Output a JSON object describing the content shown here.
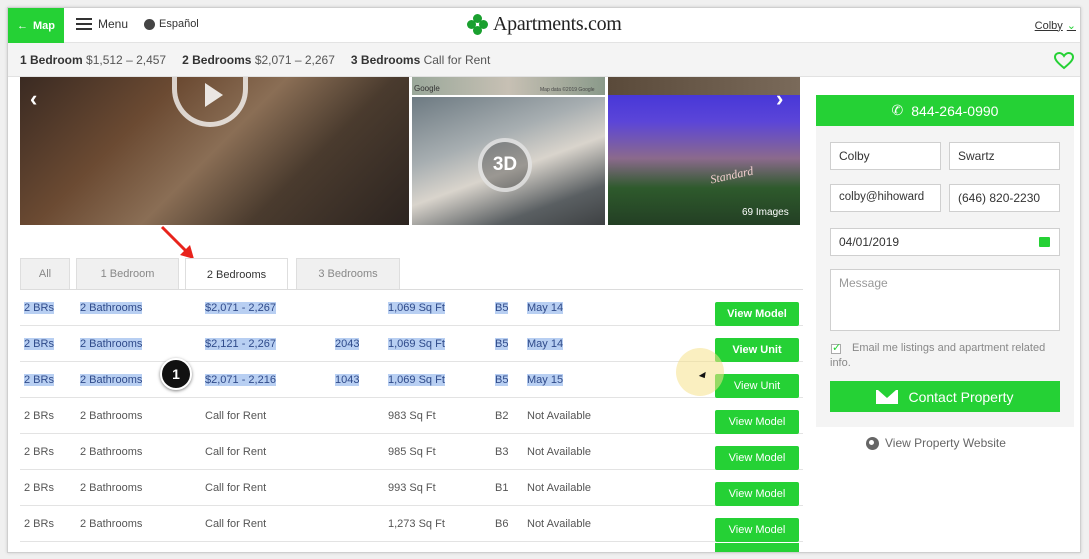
{
  "header": {
    "map_label": "Map",
    "menu_label": "Menu",
    "language_label": "Español",
    "logo_text": "Apartments.com",
    "user_name": "Colby"
  },
  "price_bar": {
    "items": [
      {
        "label": "1 Bedroom",
        "value": "$1,512 – 2,457"
      },
      {
        "label": "2 Bedrooms",
        "value": "$2,071 – 2,267"
      },
      {
        "label": "3 Bedrooms",
        "value": "Call for Rent"
      }
    ]
  },
  "gallery": {
    "image_count": "69 Images",
    "badge_3d": "3D",
    "map_logo": "Google",
    "map_data": "Map data ©2019 Google",
    "storefront_sign": "Standard"
  },
  "tabs": [
    {
      "label": "All",
      "active": false
    },
    {
      "label": "1 Bedroom",
      "active": false
    },
    {
      "label": "2 Bedrooms",
      "active": true
    },
    {
      "label": "3 Bedrooms",
      "active": false
    }
  ],
  "units": [
    {
      "beds": "2 BRs",
      "baths": "2 Bathrooms",
      "price": "$2,071 - 2,267",
      "unit": "",
      "sqft": "1,069 Sq Ft",
      "plan": "B5",
      "avail": "May 14",
      "button": "View Model",
      "selected": true
    },
    {
      "beds": "2 BRs",
      "baths": "2 Bathrooms",
      "price": "$2,121 - 2,267",
      "unit": "2043",
      "sqft": "1,069 Sq Ft",
      "plan": "B5",
      "avail": "May 14",
      "button": "View Unit",
      "selected": true
    },
    {
      "beds": "2 BRs",
      "baths": "2 Bathrooms",
      "price": "$2,071 - 2,216",
      "unit": "1043",
      "sqft": "1,069 Sq Ft",
      "plan": "B5",
      "avail": "May 15",
      "button": "View Unit",
      "selected": true
    },
    {
      "beds": "2 BRs",
      "baths": "2 Bathrooms",
      "price": "Call for Rent",
      "unit": "",
      "sqft": "983 Sq Ft",
      "plan": "B2",
      "avail": "Not Available",
      "button": "View Model",
      "selected": false
    },
    {
      "beds": "2 BRs",
      "baths": "2 Bathrooms",
      "price": "Call for Rent",
      "unit": "",
      "sqft": "985 Sq Ft",
      "plan": "B3",
      "avail": "Not Available",
      "button": "View Model",
      "selected": false
    },
    {
      "beds": "2 BRs",
      "baths": "2 Bathrooms",
      "price": "Call for Rent",
      "unit": "",
      "sqft": "993 Sq Ft",
      "plan": "B1",
      "avail": "Not Available",
      "button": "View Model",
      "selected": false
    },
    {
      "beds": "2 BRs",
      "baths": "2 Bathrooms",
      "price": "Call for Rent",
      "unit": "",
      "sqft": "1,273 Sq Ft",
      "plan": "B6",
      "avail": "Not Available",
      "button": "View Model",
      "selected": false
    }
  ],
  "annotation": {
    "step_number": "1"
  },
  "contact_form": {
    "phone": "844-264-0990",
    "first_name": "Colby",
    "last_name": "Swartz",
    "email": "colby@hihoward",
    "phone_value": "(646) 820-2230",
    "move_date": "04/01/2019",
    "message_placeholder": "Message",
    "email_opt_in": "Email me listings and apartment related info.",
    "submit_label": "Contact Property",
    "website_label": "View Property Website"
  },
  "colors": {
    "brand_green": "#25d135",
    "selection_blue": "#b8cff2",
    "annotation_red": "#e8231c"
  }
}
